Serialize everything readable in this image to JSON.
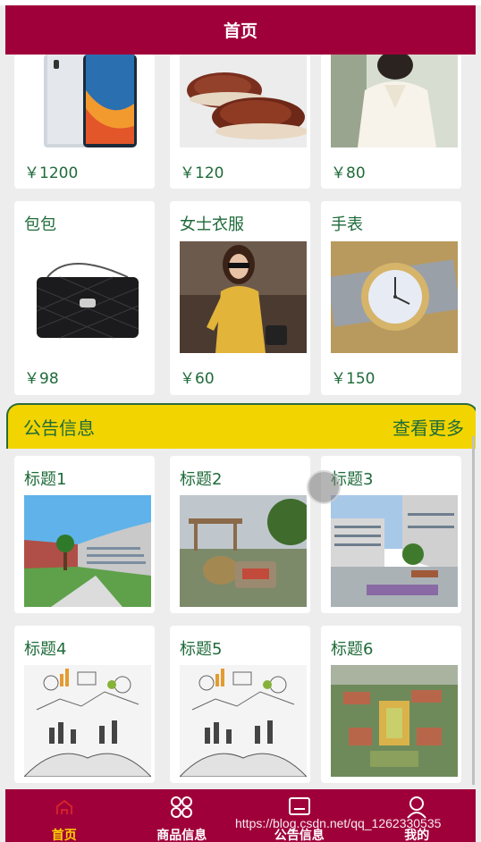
{
  "header": {
    "title": "首页"
  },
  "products_partial": [
    {
      "price": "￥1200",
      "image": "smartphone"
    },
    {
      "price": "￥120",
      "image": "leather-shoes"
    },
    {
      "price": "￥80",
      "image": "white-blouse"
    }
  ],
  "products": [
    {
      "title": "包包",
      "price": "￥98",
      "image": "handbag"
    },
    {
      "title": "女士衣服",
      "price": "￥60",
      "image": "woman-clothes"
    },
    {
      "title": "手表",
      "price": "￥150",
      "image": "wristwatch"
    }
  ],
  "notice_bar": {
    "title": "公告信息",
    "more": "查看更多"
  },
  "notices": [
    {
      "title": "标题1",
      "image": "campus-building"
    },
    {
      "title": "标题2",
      "image": "campus-sculpture"
    },
    {
      "title": "标题3",
      "image": "campus-plaza"
    },
    {
      "title": "标题4",
      "image": "open-book-infographic"
    },
    {
      "title": "标题5",
      "image": "open-book-infographic"
    },
    {
      "title": "标题6",
      "image": "campus-aerial"
    }
  ],
  "tabbar": {
    "items": [
      {
        "label": "首页",
        "icon": "home-icon",
        "active": true
      },
      {
        "label": "商品信息",
        "icon": "grid-icon",
        "active": false
      },
      {
        "label": "公告信息",
        "icon": "notice-icon",
        "active": false
      },
      {
        "label": "我的",
        "icon": "user-icon",
        "active": false
      }
    ]
  },
  "watermark": "https://blog.csdn.net/qq_1262330535",
  "colors": {
    "primary": "#a0003a",
    "accent": "#f2d400",
    "text_green": "#1f6b3a",
    "active_tab": "#ffd400"
  }
}
